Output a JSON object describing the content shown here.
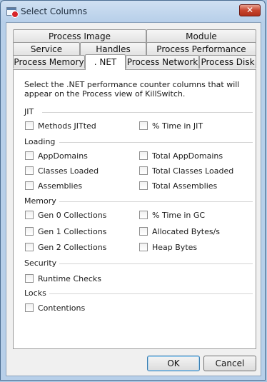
{
  "window": {
    "title": "Select Columns",
    "close_symbol": "✕"
  },
  "tabs": {
    "row1": [
      "Process Image",
      "Module"
    ],
    "row2": [
      "Service",
      "Handles",
      "Process Performance"
    ],
    "row3": [
      "Process Memory",
      ". NET",
      "Process Network",
      "Process Disk"
    ],
    "active": ". NET"
  },
  "panel": {
    "description": "Select the .NET performance counter columns that will appear on the Process view of KillSwitch.",
    "groups": {
      "jit": {
        "label": "JIT",
        "items": [
          "Methods JITted",
          "% Time in JIT"
        ]
      },
      "loading": {
        "label": "Loading",
        "items": [
          "AppDomains",
          "Total AppDomains",
          "Classes Loaded",
          "Total Classes Loaded",
          "Assemblies",
          "Total Assemblies"
        ]
      },
      "memory": {
        "label": "Memory",
        "items": [
          "Gen 0 Collections",
          "% Time in GC",
          "Gen 1 Collections",
          "Allocated Bytes/s",
          "Gen 2 Collections",
          "Heap Bytes"
        ]
      },
      "security": {
        "label": "Security",
        "items": [
          "Runtime Checks"
        ]
      },
      "locks": {
        "label": "Locks",
        "items": [
          "Contentions"
        ]
      }
    }
  },
  "buttons": {
    "ok": "OK",
    "cancel": "Cancel"
  }
}
